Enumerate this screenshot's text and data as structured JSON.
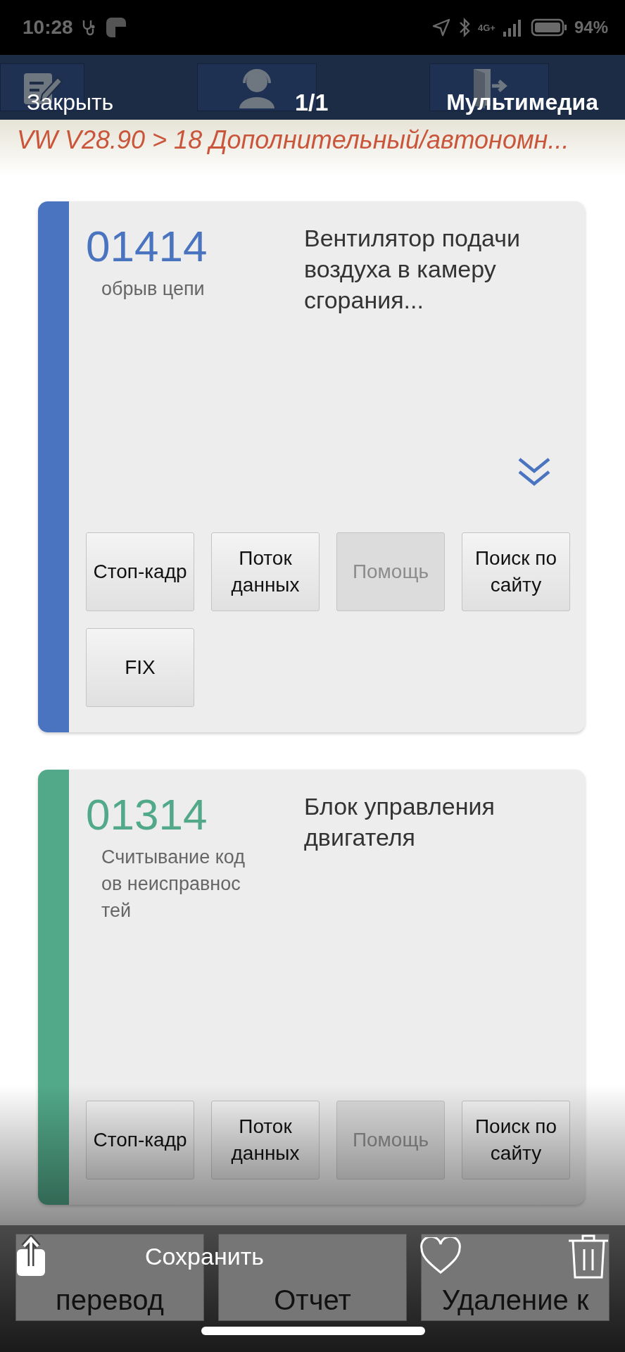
{
  "status_bar": {
    "time": "10:28",
    "network": "4G+",
    "battery": "94%"
  },
  "viewer": {
    "close": "Закрыть",
    "counter": "1/1",
    "title": "Мультимедиа"
  },
  "breadcrumb": "VW V28.90 > 18 Дополнительный/автономн...",
  "faults": [
    {
      "code": "01414",
      "color": "#4a74c0",
      "status": "обрыв цепи",
      "description": "Вентилятор подачи воздуха в камеру сгорания...",
      "expandable": true,
      "buttons": [
        {
          "label": "Стоп-кадр",
          "disabled": false
        },
        {
          "label": "Поток данных",
          "disabled": false
        },
        {
          "label": "Помощь",
          "disabled": true
        },
        {
          "label": "Поиск по сайту",
          "disabled": false
        },
        {
          "label": "FIX",
          "disabled": false
        }
      ]
    },
    {
      "code": "01314",
      "color": "#52a98a",
      "status": "Считывание кодов неисправностей",
      "description": "Блок управления двигателя",
      "expandable": false,
      "buttons": [
        {
          "label": "Стоп-кадр",
          "disabled": false
        },
        {
          "label": "Поток данных",
          "disabled": false
        },
        {
          "label": "Помощь",
          "disabled": true
        },
        {
          "label": "Поиск по сайту",
          "disabled": false
        }
      ]
    }
  ],
  "bottom_buttons": [
    "перевод",
    "Отчет",
    "Удаление к"
  ],
  "actions": {
    "save": "Сохранить"
  }
}
